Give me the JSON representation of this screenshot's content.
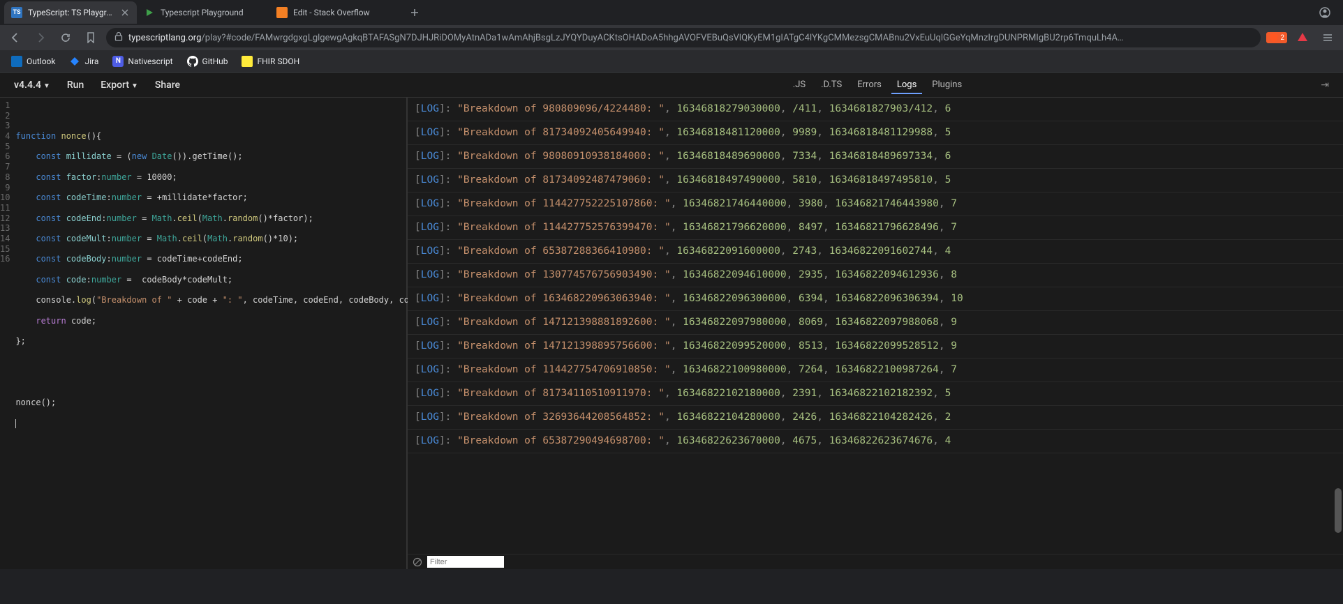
{
  "tabs": [
    {
      "title": "TypeScript: TS Playground - An",
      "active": true,
      "icon": "ts"
    },
    {
      "title": "Typescript Playground",
      "active": false,
      "icon": "ts-green"
    },
    {
      "title": "Edit - Stack Overflow",
      "active": false,
      "icon": "so"
    }
  ],
  "url_host": "typescriptlang.org",
  "url_path": "/play?#code/FAMwrgdgxgLglgewgAgkqBTAFASgN7DJHJRiDOMyAtnADa1wAmAhjBsgLzJYQYDuyACKtsOHADoA5hhgAVOFVEBuQsVlQKyEM1gIATgC4lYKgCMMezsgCMABnu2VxEuUqlGGeYqMnzIrgDUNPRMIgBU2rp6TmquLh4A…",
  "ext_badge_count": "2",
  "bookmarks": [
    {
      "label": "Outlook",
      "icon": "outlook"
    },
    {
      "label": "Jira",
      "icon": "jira"
    },
    {
      "label": "Nativescript",
      "icon": "nativescript"
    },
    {
      "label": "GitHub",
      "icon": "github"
    },
    {
      "label": "FHIR SDOH",
      "icon": "fhir"
    }
  ],
  "pg_version": "v4.4.4",
  "pg_menu": {
    "run": "Run",
    "export": "Export",
    "share": "Share"
  },
  "right_tabs": [
    ".JS",
    ".D.TS",
    "Errors",
    "Logs",
    "Plugins"
  ],
  "right_tab_active": 3,
  "code_lines": 16,
  "code": {
    "l1": "",
    "l2_fn": "function",
    "l2_name": " nonce",
    "l2_rest": "(){",
    "l3_kw": "const",
    "l3_var": " millidate ",
    "l3_eq": "= (",
    "l3_new": "new ",
    "l3_cls": "Date",
    "l3_rest": "()).getTime();",
    "l4_kw": "const",
    "l4_var": " factor",
    "l4_t": ":",
    "l4_ty": "number",
    "l4_rest": " = 10000;",
    "l5_kw": "const",
    "l5_var": " codeTime",
    "l5_t": ":",
    "l5_ty": "number",
    "l5_rest": " = +millidate*factor;",
    "l6_kw": "const",
    "l6_var": " codeEnd",
    "l6_t": ":",
    "l6_ty": "number",
    "l6_eq": " = ",
    "l6_math": "Math",
    "l6_d1": ".",
    "l6_ceil": "ceil",
    "l6_p1": "(",
    "l6_math2": "Math",
    "l6_d2": ".",
    "l6_rand": "random",
    "l6_rest": "()*factor);",
    "l7_kw": "const",
    "l7_var": " codeMult",
    "l7_t": ":",
    "l7_ty": "number",
    "l7_eq": " = ",
    "l7_math": "Math",
    "l7_d1": ".",
    "l7_ceil": "ceil",
    "l7_p1": "(",
    "l7_math2": "Math",
    "l7_d2": ".",
    "l7_rand": "random",
    "l7_rest": "()*10);",
    "l8_kw": "const",
    "l8_var": " codeBody",
    "l8_t": ":",
    "l8_ty": "number",
    "l8_rest": " = codeTime+codeEnd;",
    "l9_kw": "const",
    "l9_var": " code",
    "l9_t": ":",
    "l9_ty": "number",
    "l9_rest": " =  codeBody*codeMult;",
    "l10_a": "    console.",
    "l10_log": "log",
    "l10_p": "(",
    "l10_s1": "\"Breakdown of \"",
    "l10_b": " + code + ",
    "l10_s2": "\": \"",
    "l10_c": ", codeTime, codeEnd, codeBody, codeMult);",
    "l11_kw": "return",
    "l11_rest": " code;",
    "l12": "};",
    "l15": "nonce();"
  },
  "logs": [
    {
      "code": "980809096/4224480",
      "t": "16346818279030000",
      "e": "/411",
      "b": "1634681827903/412",
      "m": "6"
    },
    {
      "code": "81734092405649940",
      "t": "16346818481120000",
      "e": "9989",
      "b": "16346818481129988",
      "m": "5"
    },
    {
      "code": "98080910938184000",
      "t": "16346818489690000",
      "e": "7334",
      "b": "16346818489697334",
      "m": "6"
    },
    {
      "code": "81734092487479060",
      "t": "16346818497490000",
      "e": "5810",
      "b": "16346818497495810",
      "m": "5"
    },
    {
      "code": "114427752225107860",
      "t": "16346821746440000",
      "e": "3980",
      "b": "16346821746443980",
      "m": "7"
    },
    {
      "code": "114427752576399470",
      "t": "16346821796620000",
      "e": "8497",
      "b": "16346821796628496",
      "m": "7"
    },
    {
      "code": "65387288366410980",
      "t": "16346822091600000",
      "e": "2743",
      "b": "16346822091602744",
      "m": "4"
    },
    {
      "code": "130774576756903490",
      "t": "16346822094610000",
      "e": "2935",
      "b": "16346822094612936",
      "m": "8"
    },
    {
      "code": "163468220963063940",
      "t": "16346822096300000",
      "e": "6394",
      "b": "16346822096306394",
      "m": "10"
    },
    {
      "code": "147121398881892600",
      "t": "16346822097980000",
      "e": "8069",
      "b": "16346822097988068",
      "m": "9"
    },
    {
      "code": "147121398895756600",
      "t": "16346822099520000",
      "e": "8513",
      "b": "16346822099528512",
      "m": "9"
    },
    {
      "code": "114427754706910850",
      "t": "16346822100980000",
      "e": "7264",
      "b": "16346822100987264",
      "m": "7"
    },
    {
      "code": "81734110510911970",
      "t": "16346822102180000",
      "e": "2391",
      "b": "16346822102182392",
      "m": "5"
    },
    {
      "code": "32693644208564852",
      "t": "16346822104280000",
      "e": "2426",
      "b": "16346822104282426",
      "m": "2"
    },
    {
      "code": "65387290494698700",
      "t": "16346822623670000",
      "e": "4675",
      "b": "16346822623674676",
      "m": "4"
    }
  ],
  "filter_placeholder": "Filter"
}
